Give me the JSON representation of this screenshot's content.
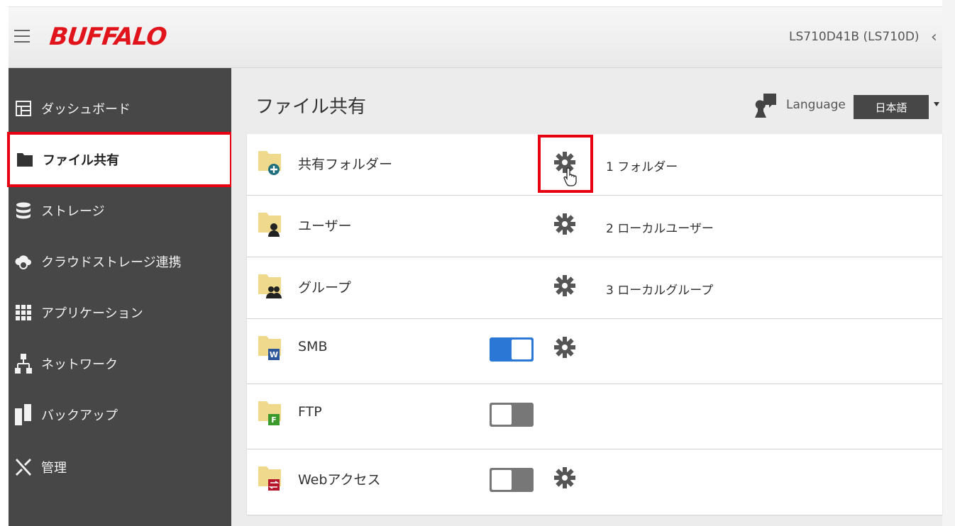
{
  "header": {
    "brand": "BUFFALO",
    "device_name": "LS710D41B (LS710D)"
  },
  "sidebar": {
    "items": [
      {
        "label": "ダッシュボード",
        "icon": "dashboard-icon"
      },
      {
        "label": "ファイル共有",
        "icon": "folder-icon",
        "active": true
      },
      {
        "label": "ストレージ",
        "icon": "database-icon"
      },
      {
        "label": "クラウドストレージ連携",
        "icon": "cloud-icon"
      },
      {
        "label": "アプリケーション",
        "icon": "grid-icon"
      },
      {
        "label": "ネットワーク",
        "icon": "network-icon"
      },
      {
        "label": "バックアップ",
        "icon": "backup-icon"
      },
      {
        "label": "管理",
        "icon": "tools-icon"
      }
    ]
  },
  "main": {
    "title": "ファイル共有",
    "language_label": "Language",
    "language_value": "日本語",
    "rows": [
      {
        "label": "共有フォルダー",
        "info": "1 フォルダー",
        "icon": "folder-plus-icon"
      },
      {
        "label": "ユーザー",
        "info": "2 ローカルユーザー",
        "icon": "folder-user-icon"
      },
      {
        "label": "グループ",
        "info": "3 ローカルグループ",
        "icon": "folder-group-icon"
      },
      {
        "label": "SMB",
        "toggle": "on",
        "icon": "folder-smb-icon"
      },
      {
        "label": "FTP",
        "toggle": "off",
        "icon": "folder-ftp-icon"
      },
      {
        "label": "Webアクセス",
        "toggle": "off",
        "icon": "folder-web-icon"
      }
    ]
  },
  "colors": {
    "brand_red": "#e1141c",
    "highlight_red": "#e60012",
    "sidebar_bg": "#474747",
    "toggle_on": "#2a77d5"
  }
}
